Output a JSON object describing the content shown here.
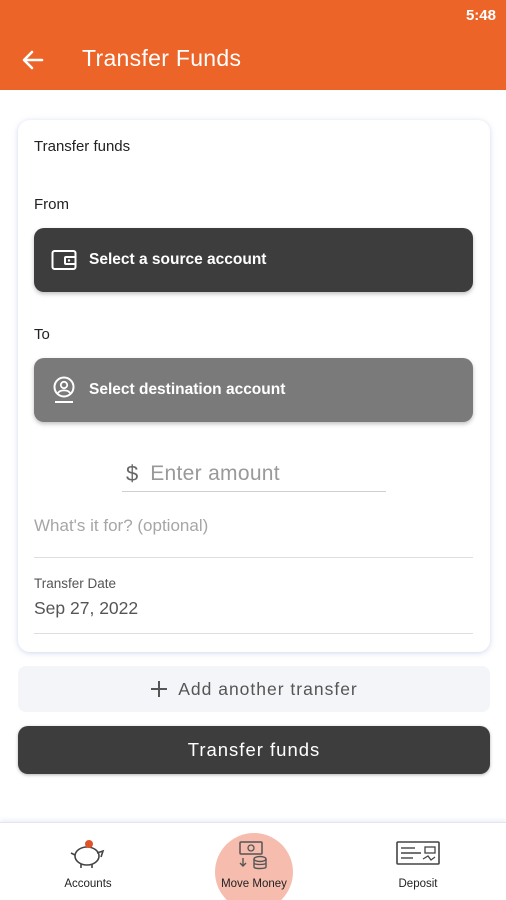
{
  "status_bar": {
    "time": "5:48"
  },
  "header": {
    "title": "Transfer Funds",
    "background_color": "#ec6428",
    "back_icon": "arrow-left-icon"
  },
  "form": {
    "card_title": "Transfer funds",
    "from_label": "From",
    "source_button": {
      "label": "Select a source account",
      "icon": "wallet-icon",
      "color": "#3d3d3d"
    },
    "to_label": "To",
    "destination_button": {
      "label": "Select destination account",
      "icon": "user-circle-icon",
      "color": "#7a7a7a"
    },
    "amount": {
      "currency_symbol": "$",
      "placeholder": "Enter amount",
      "value": ""
    },
    "memo": {
      "placeholder": "What's it for? (optional)",
      "value": ""
    },
    "transfer_date": {
      "label": "Transfer Date",
      "value": "Sep 27, 2022"
    }
  },
  "add_transfer": {
    "icon": "plus-icon",
    "label": "Add another transfer"
  },
  "submit": {
    "label": "Transfer funds"
  },
  "bottom_nav": {
    "items": [
      {
        "label": "Accounts",
        "icon": "piggy-bank-icon",
        "active": false
      },
      {
        "label": "Move Money",
        "icon": "money-transfer-icon",
        "active": true
      },
      {
        "label": "Deposit",
        "icon": "check-deposit-icon",
        "active": false
      }
    ],
    "active_highlight_color": "#f6bcae"
  }
}
